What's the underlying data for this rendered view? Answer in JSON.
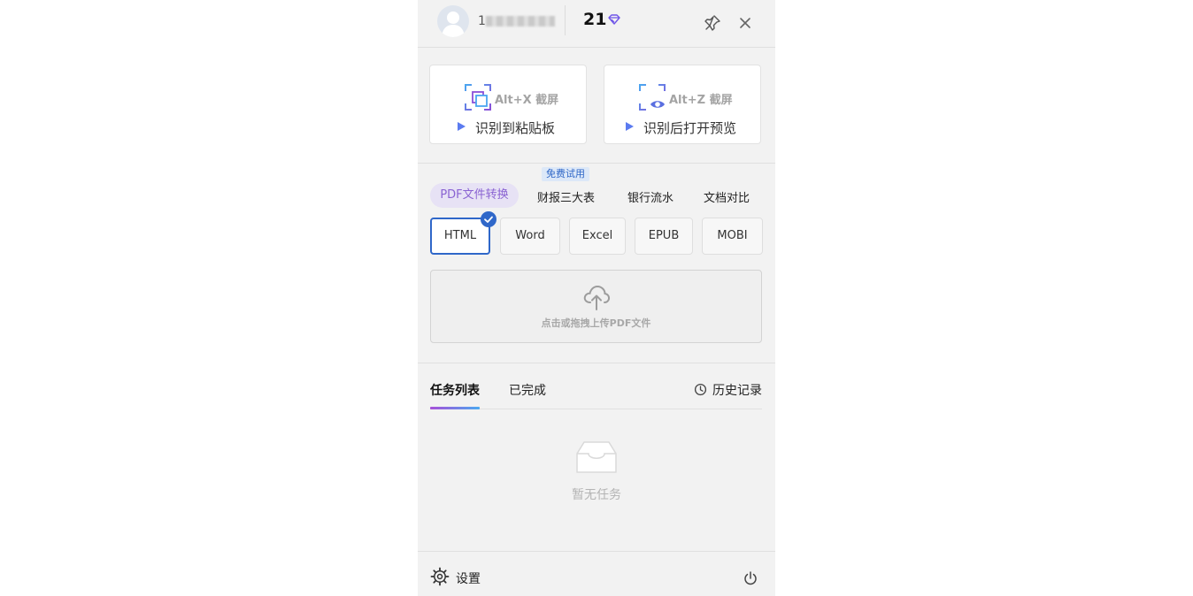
{
  "header": {
    "username_prefix": "1",
    "points": "21",
    "icons": {
      "avatar": "avatar-icon",
      "gem": "diamond-icon",
      "pin": "pin-icon",
      "close": "close-icon"
    }
  },
  "capture": {
    "screen_clipboard": {
      "hotkey": "Alt+X 截屏",
      "label": "识别到粘贴板"
    },
    "screen_preview": {
      "hotkey": "Alt+Z 截屏",
      "label": "识别后打开预览"
    }
  },
  "conversion": {
    "free_badge": "免费试用",
    "tabs": [
      "PDF文件转换",
      "财报三大表",
      "银行流水",
      "文档对比"
    ],
    "active_tab": "PDF文件转换",
    "formats": [
      "HTML",
      "Word",
      "Excel",
      "EPUB",
      "MOBI"
    ],
    "selected_format": "HTML",
    "upload_text": "点击或拖拽上传PDF文件"
  },
  "tasks": {
    "tabs": [
      "任务列表",
      "已完成"
    ],
    "active_tab": "任务列表",
    "history_label": "历史记录",
    "empty_text": "暂无任务"
  },
  "footer": {
    "settings_label": "设置"
  },
  "colors": {
    "accent": "#2f67c9",
    "purple": "#8a63d2",
    "panel_bg": "#f2f2f2"
  }
}
